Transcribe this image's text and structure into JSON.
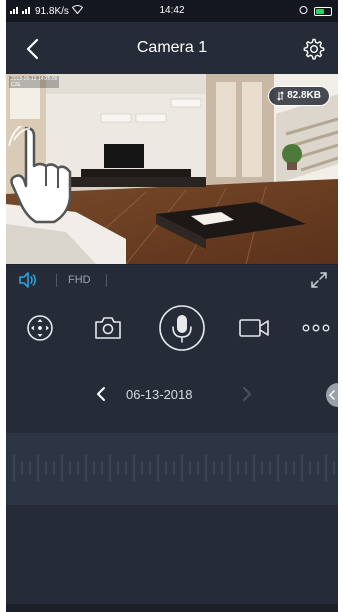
{
  "status_bar": {
    "network": "91.8K/s",
    "time": "14:42"
  },
  "header": {
    "title": "Camera 1"
  },
  "video": {
    "speed": "82.8KB",
    "overlay_line1": "2018-06-13 14:25:00",
    "overlay_line2": "C2E"
  },
  "strip": {
    "quality": "FHD"
  },
  "date_nav": {
    "date": "06-13-2018"
  },
  "colors": {
    "accent": "#29a3e0",
    "background": "#262b38",
    "timeline": "#2d3443"
  }
}
